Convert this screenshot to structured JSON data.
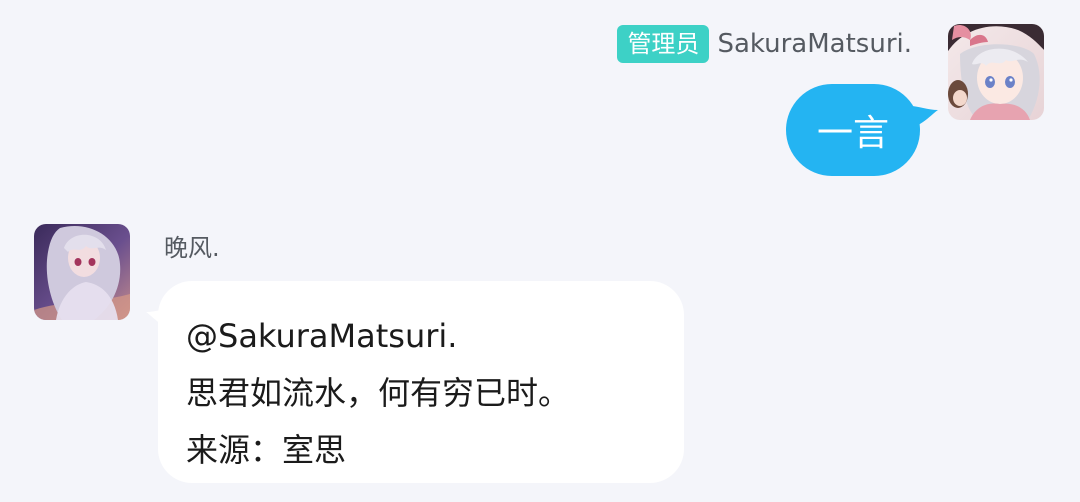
{
  "messages": [
    {
      "side": "right",
      "sender": {
        "role_badge": "管理员",
        "name": "SakuraMatsuri.",
        "avatar": "anime-girl-avatar"
      },
      "text": "一言",
      "bubble_color": "#24b4f2"
    },
    {
      "side": "left",
      "sender": {
        "name": "晚风.",
        "avatar": "anime-girl-avatar"
      },
      "lines": [
        "@SakuraMatsuri.",
        "思君如流水，何有穷已时。",
        "来源：室思"
      ],
      "bubble_color": "#ffffff"
    }
  ],
  "colors": {
    "background": "#f4f5fa",
    "admin_badge": "#3dd1c6",
    "outgoing_bubble": "#24b4f2",
    "incoming_bubble": "#ffffff"
  }
}
